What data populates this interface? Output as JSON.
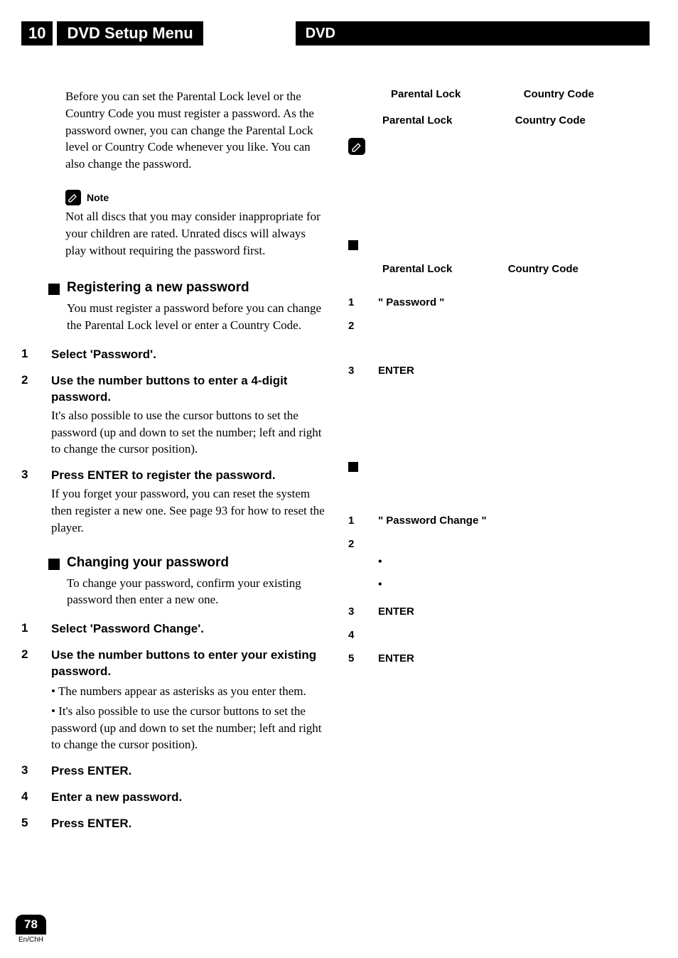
{
  "header": {
    "chapter": "10",
    "title": "DVD Setup Menu",
    "sub": "DVD"
  },
  "left": {
    "intro": "Before you can set the Parental Lock level or the Country Code you must register a password. As the password owner, you can change the Parental Lock level or Country Code whenever you like. You can also change the password.",
    "note_label": "Note",
    "note_text": "Not all discs that you may consider inappropriate for your children are rated. Unrated discs will always play without requiring the password first.",
    "section_a": {
      "heading": "Registering a new password",
      "body": "You must register a password before you can change the Parental Lock level or enter a Country Code.",
      "steps": [
        {
          "num": "1",
          "title": "Select 'Password'."
        },
        {
          "num": "2",
          "title": "Use the number buttons to enter a 4-digit password.",
          "body": "It's also possible to use the cursor buttons to set the password (up and down to set the number; left and right to change the cursor position)."
        },
        {
          "num": "3",
          "title": "Press ENTER to register the password.",
          "body": "If you forget your password, you can reset the system then register a new one. See page 93 for how to reset the player."
        }
      ]
    },
    "section_b": {
      "heading": "Changing your password",
      "body": "To change your password, confirm your existing password then enter a new one.",
      "steps": [
        {
          "num": "1",
          "title": "Select 'Password Change'."
        },
        {
          "num": "2",
          "title": "Use the number buttons to enter your existing password.",
          "bullets": [
            "The numbers appear as asterisks as you enter them.",
            "It's also possible to use the cursor buttons to set the password (up and down to set the number; left and right to change the cursor position)."
          ]
        },
        {
          "num": "3",
          "title": "Press ENTER."
        },
        {
          "num": "4",
          "title": "Enter a new password."
        },
        {
          "num": "5",
          "title": "Press ENTER."
        }
      ]
    }
  },
  "right": {
    "labels": {
      "parental_lock": "Parental Lock",
      "country_code": "Country Code",
      "password": "\" Password \"",
      "password_change": "\" Password Change \"",
      "enter": "ENTER"
    },
    "section_a_steps": [
      "1",
      "2",
      "3"
    ],
    "section_b_steps": [
      "1",
      "2",
      "3",
      "4",
      "5"
    ]
  },
  "footer": {
    "page": "78",
    "lang": "En/ChH"
  }
}
